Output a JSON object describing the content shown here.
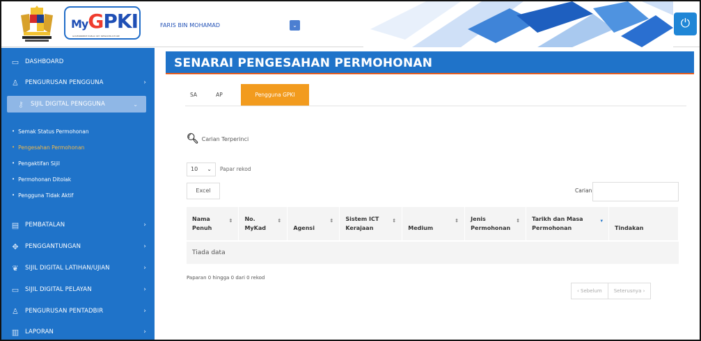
{
  "header": {
    "logo_sub": "GOVERNMENT PUBLIC KEY INFRASTRUCTURE",
    "user_name": "FARIS BIN MOHAMAD",
    "user_dropdown_icon": "chevron-down-icon",
    "power_icon": "power-icon"
  },
  "sidebar": {
    "items": [
      {
        "label": "DASHBOARD",
        "icon": "monitor-icon",
        "chevron": ""
      },
      {
        "label": "PENGURUSAN PENGGUNA",
        "icon": "user-icon",
        "chevron": "›"
      },
      {
        "label": "SIJIL DIGITAL PENGGUNA",
        "icon": "key-icon",
        "chevron": "⌄"
      },
      {
        "label": "PEMBATALAN",
        "icon": "list-icon",
        "chevron": "›"
      },
      {
        "label": "PENGGANTUNGAN",
        "icon": "move-icon",
        "chevron": "›"
      },
      {
        "label": "SIJIL DIGITAL LATIHAN/UJIAN",
        "icon": "leaf-icon",
        "chevron": "›"
      },
      {
        "label": "SIJIL DIGITAL PELAYAN",
        "icon": "monitor-icon",
        "chevron": "›"
      },
      {
        "label": "PENGURUSAN PENTADBIR",
        "icon": "user-icon",
        "chevron": "›"
      },
      {
        "label": "LAPORAN",
        "icon": "chart-icon",
        "chevron": "›"
      }
    ],
    "subitems": [
      {
        "label": "Semak Status Permohonan"
      },
      {
        "label": "Pengesahan Permohonan"
      },
      {
        "label": "Pengaktifan Sijil"
      },
      {
        "label": "Permohonan Ditolak"
      },
      {
        "label": "Pengguna Tidak Aktif"
      }
    ]
  },
  "main": {
    "title": "SENARAI PENGESAHAN PERMOHONAN",
    "tabs": [
      {
        "label": "SA"
      },
      {
        "label": "AP"
      },
      {
        "label": "Pengguna GPKI"
      }
    ],
    "advanced_search": "Carian Terperinci",
    "page_length": "10",
    "page_length_label": "Papar rekod",
    "excel_label": "Excel",
    "search_label": "Carian:",
    "search_value": "",
    "table": {
      "headers": [
        [
          "Nama",
          "Penuh"
        ],
        [
          "No.",
          "MyKad"
        ],
        [
          "",
          "Agensi"
        ],
        [
          "Sistem ICT",
          "Kerajaan"
        ],
        [
          "",
          "Medium"
        ],
        [
          "Jenis",
          "Permohonan"
        ],
        [
          "Tarikh dan Masa",
          "Permohonan"
        ],
        [
          "",
          "Tindakan"
        ]
      ],
      "empty_text": "Tiada data"
    },
    "info_text": "Paparan 0 hingga 0 dari 0 rekod",
    "prev_label": "‹ Sebelum",
    "next_label": "Seterusnya ›"
  }
}
